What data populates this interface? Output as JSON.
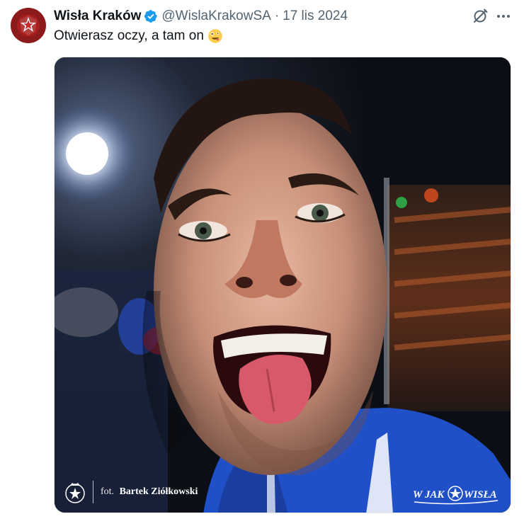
{
  "author": {
    "name": "Wisła Kraków",
    "handle": "@WislaKrakowSA",
    "separator": "·",
    "date": "17 lis 2024",
    "verified_color": "#1d9bf0"
  },
  "tweet": {
    "text": "Otwierasz oczy, a tam on",
    "emoji": "zany-face-emoji"
  },
  "media": {
    "photo_credit_prefix": "fot.",
    "photo_credit_name": "Bartek Ziółkowski",
    "slogan_left": "W JAK",
    "slogan_right": "WISŁA"
  },
  "icons": {
    "grok": "grok-icon",
    "more": "more-icon"
  },
  "colors": {
    "brand_red": "#8c1a1a",
    "text_primary": "#0f1419",
    "text_secondary": "#536471",
    "jersey_blue": "#1e4bc8"
  }
}
